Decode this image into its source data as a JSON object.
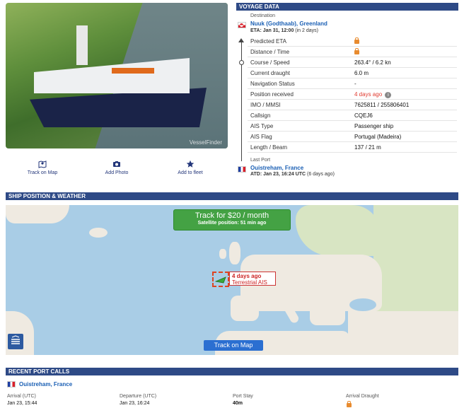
{
  "photo": {
    "watermark": "VesselFinder"
  },
  "actions": [
    {
      "label": "Track on Map",
      "icon": "map-marker-icon"
    },
    {
      "label": "Add Photo",
      "icon": "camera-icon"
    },
    {
      "label": "Add to fleet",
      "icon": "star-icon"
    }
  ],
  "voyage": {
    "header": "VOYAGE DATA",
    "destination_label": "Destination",
    "destination": "Nuuk (Godthaab), Greenland",
    "eta": "ETA: Jan 31, 12:00",
    "eta_rel": "(in 2 days)",
    "rows": [
      {
        "key": "Predicted ETA",
        "value": "",
        "locked": true
      },
      {
        "key": "Distance / Time",
        "value": "",
        "locked": true
      },
      {
        "key": "Course / Speed",
        "value": "263.4° / 6.2 kn"
      },
      {
        "key": "Current draught",
        "value": "6.0 m"
      },
      {
        "key": "Navigation Status",
        "value": "-"
      },
      {
        "key": "Position received",
        "value": "4 days ago",
        "alert": true
      },
      {
        "key": "IMO / MMSI",
        "value": "7625811 / 255806401"
      },
      {
        "key": "Callsign",
        "value": "CQEJ6"
      },
      {
        "key": "AIS Type",
        "value": "Passenger ship"
      },
      {
        "key": "AIS Flag",
        "value": "Portugal (Madeira)"
      },
      {
        "key": "Length / Beam",
        "value": "137 / 21 m"
      }
    ],
    "last_port_label": "Last Port",
    "last_port": "Ouistreham, France",
    "atd": "ATD: Jan 23, 16:24 UTC",
    "atd_rel": "(6 days ago)"
  },
  "map": {
    "header": "SHIP POSITION & WEATHER",
    "promo_title": "Track for $20 / month",
    "promo_sub": "Satellite position: 51 min ago",
    "ship_age": "4 days ago",
    "ship_source": "Terrestrial AIS",
    "button": "Track on Map"
  },
  "recent": {
    "header": "RECENT PORT CALLS",
    "port": "Ouistreham, France",
    "cols": [
      {
        "label": "Arrival (UTC)",
        "value": "Jan 23, 15:44"
      },
      {
        "label": "Departure (UTC)",
        "value": "Jan 23, 16:24"
      },
      {
        "label": "Port Stay",
        "value": "40m"
      },
      {
        "label": "Arrival Draught",
        "value": ""
      }
    ]
  },
  "colors": {
    "header": "#2e4a86",
    "link": "#1a5fb4",
    "alert": "#e03a2f",
    "lock": "#e88b2f",
    "promo": "#44a244"
  }
}
